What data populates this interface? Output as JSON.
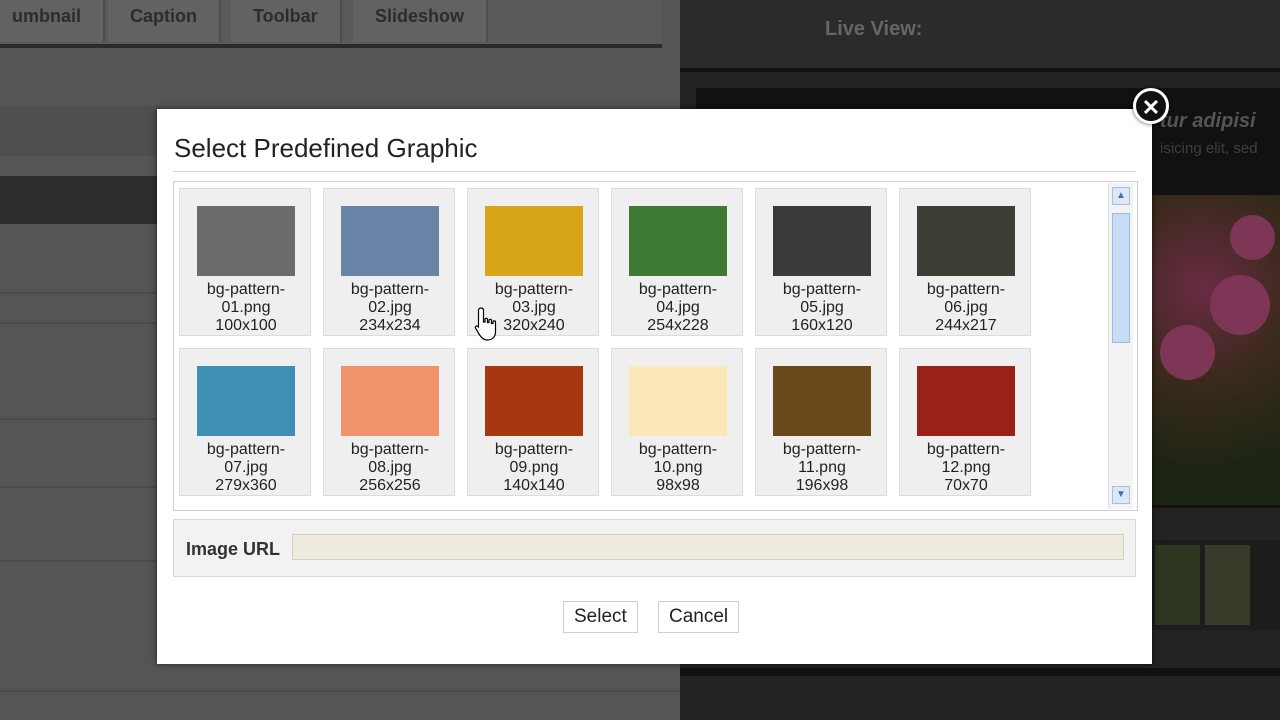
{
  "background": {
    "tabs": [
      "umbnail",
      "Caption",
      "Toolbar",
      "Slideshow"
    ],
    "live_view_label": "Live View:",
    "live_text_line1": "tur adipisi",
    "live_text_line2": "isicing elit, sed"
  },
  "dialog": {
    "title": "Select Predefined Graphic",
    "close_glyph": "✕",
    "graphics": [
      {
        "name_line1": "bg-pattern-",
        "name_line2": "01.png",
        "size": "100x100",
        "swatch": "#6b6b6b"
      },
      {
        "name_line1": "bg-pattern-",
        "name_line2": "02.jpg",
        "size": "234x234",
        "swatch": "#6a84a8"
      },
      {
        "name_line1": "bg-pattern-",
        "name_line2": "03.jpg",
        "size": "320x240",
        "swatch": "#d8a418"
      },
      {
        "name_line1": "bg-pattern-",
        "name_line2": "04.jpg",
        "size": "254x228",
        "swatch": "#3f7a35"
      },
      {
        "name_line1": "bg-pattern-",
        "name_line2": "05.jpg",
        "size": "160x120",
        "swatch": "#3a3a3a"
      },
      {
        "name_line1": "bg-pattern-",
        "name_line2": "06.jpg",
        "size": "244x217",
        "swatch": "#3c3f36"
      },
      {
        "name_line1": "bg-pattern-",
        "name_line2": "07.jpg",
        "size": "279x360",
        "swatch": "#3f8fb5"
      },
      {
        "name_line1": "bg-pattern-",
        "name_line2": "08.jpg",
        "size": "256x256",
        "swatch": "#f0936b"
      },
      {
        "name_line1": "bg-pattern-",
        "name_line2": "09.png",
        "size": "140x140",
        "swatch": "#a6370f"
      },
      {
        "name_line1": "bg-pattern-",
        "name_line2": "10.png",
        "size": "98x98",
        "swatch": "#fbe7b8"
      },
      {
        "name_line1": "bg-pattern-",
        "name_line2": "11.png",
        "size": "196x98",
        "swatch": "#6a4a1a"
      },
      {
        "name_line1": "bg-pattern-",
        "name_line2": "12.png",
        "size": "70x70",
        "swatch": "#9a2118"
      }
    ],
    "image_url_label": "Image URL",
    "image_url_value": "",
    "select_label": "Select",
    "cancel_label": "Cancel"
  },
  "colors": {
    "overlay": "#4a4a4a",
    "dialog_bg": "#ffffff",
    "input_bg": "#efebde",
    "scroll_accent": "#c9dcf6"
  }
}
